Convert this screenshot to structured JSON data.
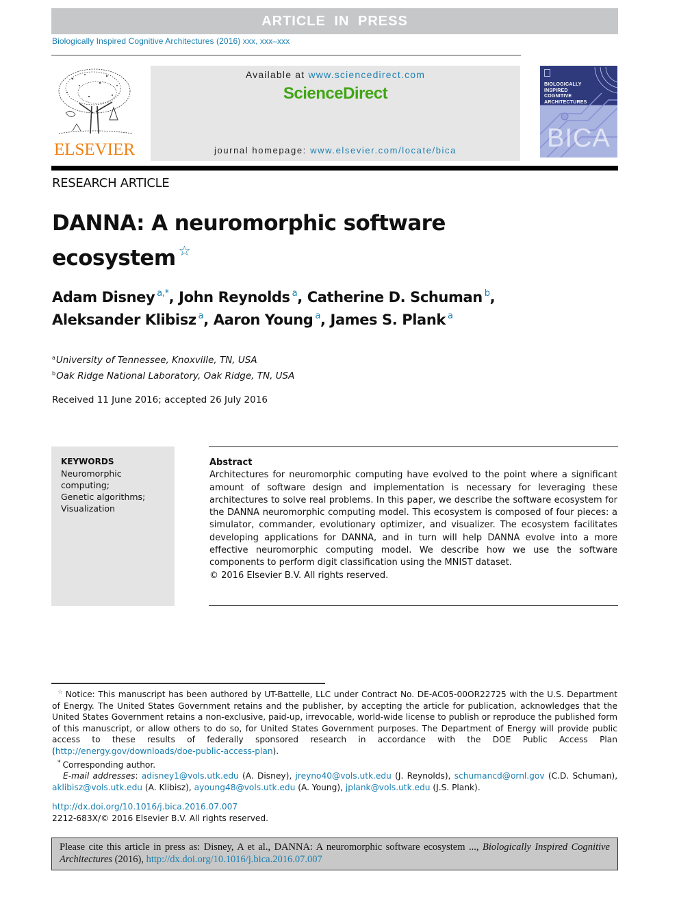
{
  "banner": {
    "text": "ARTICLE IN PRESS"
  },
  "journal_line": "Biologically Inspired Cognitive Architectures (2016) xxx, xxx–xxx",
  "header": {
    "publisher_logo_text": "ELSEVIER",
    "available_prefix": "Available at ",
    "available_link": "www.sciencedirect.com",
    "sciencedirect_logo": "ScienceDirect",
    "homepage_prefix": "journal homepage: ",
    "homepage_link": "www.elsevier.com/locate/bica",
    "cover": {
      "title_lines": [
        "BIOLOGICALLY",
        "INSPIRED",
        "COGNITIVE",
        "ARCHITECTURES"
      ],
      "acronym": "BICA",
      "colors": {
        "top": "#2e3a7c",
        "bottom": "#a9b4e0"
      }
    }
  },
  "article_type": "RESEARCH ARTICLE",
  "title": {
    "line1": "DANNA: A neuromorphic software",
    "line2": "ecosystem",
    "note_mark": "☆"
  },
  "authors": [
    {
      "name": "Adam Disney",
      "sup": "a,*",
      "sep": ", "
    },
    {
      "name": "John Reynolds",
      "sup": "a",
      "sep": ", "
    },
    {
      "name": "Catherine D. Schuman",
      "sup": "b",
      "sep": ","
    },
    {
      "name": "Aleksander Klibisz",
      "sup": "a",
      "sep": ", "
    },
    {
      "name": "Aaron Young",
      "sup": "a",
      "sep": ", "
    },
    {
      "name": "James S. Plank",
      "sup": "a",
      "sep": ""
    }
  ],
  "affiliations": [
    {
      "mark": "a",
      "text": "University of Tennessee, Knoxville, TN, USA"
    },
    {
      "mark": "b",
      "text": "Oak Ridge National Laboratory, Oak Ridge, TN, USA"
    }
  ],
  "received": "Received 11 June 2016; accepted 26 July 2016",
  "keywords": {
    "heading": "KEYWORDS",
    "items": [
      "Neuromorphic computing;",
      "Genetic algorithms;",
      "Visualization"
    ]
  },
  "abstract": {
    "heading": "Abstract",
    "body": "Architectures for neuromorphic computing have evolved to the point where a significant amount of software design and implementation is necessary for leveraging these architectures to solve real problems. In this paper, we describe the software ecosystem for the DANNA neuromorphic computing model. This ecosystem is composed of four pieces: a simulator, commander, evolutionary optimizer, and visualizer. The ecosystem facilitates developing applications for DANNA, and in turn will help DANNA evolve into a more effective neuromorphic computing model. We describe how we use the software components to perform digit classification using the MNIST dataset.",
    "copyright": "© 2016 Elsevier B.V. All rights reserved."
  },
  "footnotes": {
    "notice_mark": "☆",
    "notice_text": "Notice: This manuscript has been authored by UT-Battelle, LLC under Contract No. DE-AC05-00OR22725 with the U.S. Department of Energy. The United States Government retains and the publisher, by accepting the article for publication, acknowledges that the United States Government retains a non-exclusive, paid-up, irrevocable, world-wide license to publish or reproduce the published form of this manuscript, or allow others to do so, for United States Government purposes. The Department of Energy will provide public access to these results of federally sponsored research in accordance with the DOE Public Access Plan (",
    "notice_link": "http://energy.gov/downloads/doe-public-access-plan",
    "notice_end": ").",
    "corresponding_mark": "*",
    "corresponding_text": "Corresponding author.",
    "email_label": "E-mail addresses",
    "emails": [
      {
        "address": "adisney1@vols.utk.edu",
        "who": "(A. Disney)"
      },
      {
        "address": "jreyno40@vols.utk.edu",
        "who": "(J. Reynolds)"
      },
      {
        "address": "schumancd@ornl.gov",
        "who": "(C.D. Schuman)"
      },
      {
        "address": "aklibisz@vols.utk.edu",
        "who": "(A. Klibisz)"
      },
      {
        "address": "ayoung48@vols.utk.edu",
        "who": "(A. Young)"
      },
      {
        "address": "jplank@vols.utk.edu",
        "who": "(J.S. Plank)"
      }
    ]
  },
  "doi": "http://dx.doi.org/10.1016/j.bica.2016.07.007",
  "issn_line": "2212-683X/© 2016 Elsevier B.V. All rights reserved.",
  "cite_box": {
    "prefix": "Please cite this article in press as: Disney, A et al., DANNA: A neuromorphic software ecosystem ..., ",
    "journal": "Biologically Inspired Cognitive Architectures",
    "year": " (2016), ",
    "link": "http://dx.doi.org/10.1016/j.bica.2016.07.007"
  }
}
